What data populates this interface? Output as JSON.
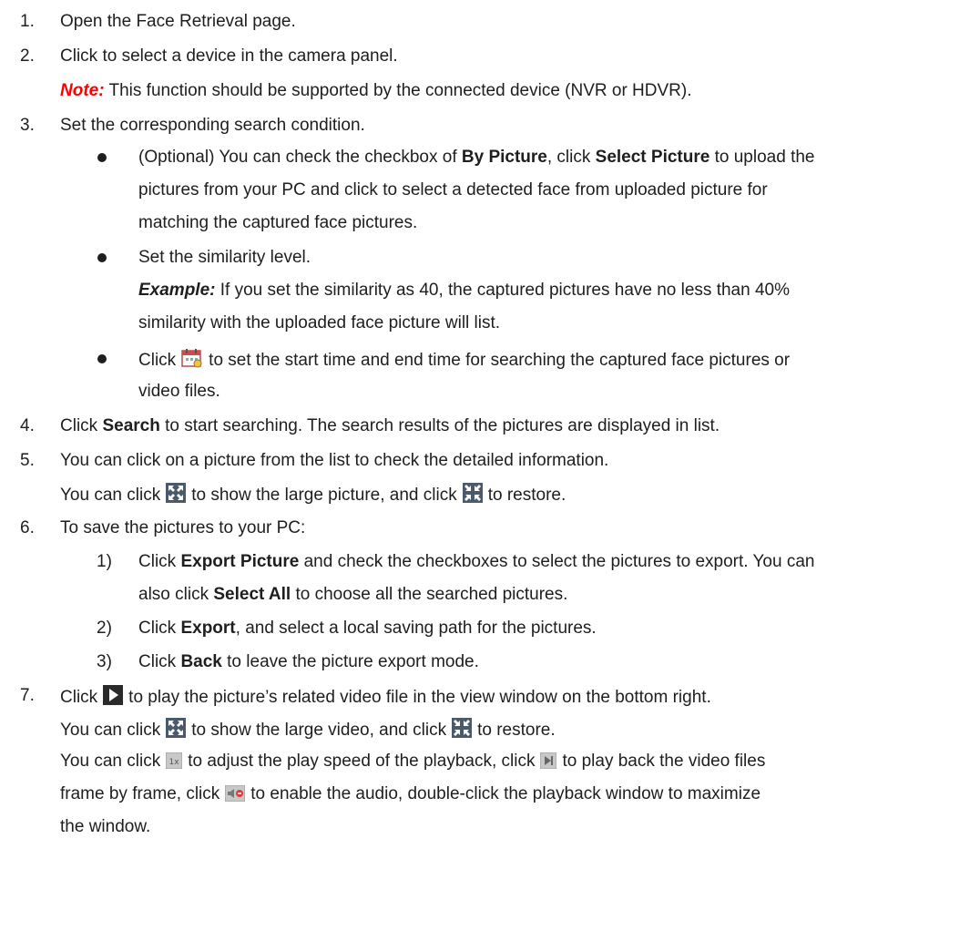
{
  "steps": [
    {
      "num": "1.",
      "text": "Open the Face Retrieval page."
    },
    {
      "num": "2.",
      "text": "Click to select a device in the camera panel."
    },
    {
      "num": "3.",
      "text": "Set the corresponding search condition."
    },
    {
      "num": "4.",
      "text_a": "Click ",
      "b1": "Search",
      "text_b": " to start searching. The search results of the pictures are displayed in list."
    },
    {
      "num": "5.",
      "text": "You can click on a picture from the list to check the detailed information."
    },
    {
      "num": "6.",
      "text": "To save the pictures to your PC:"
    },
    {
      "num": "7.",
      "text_a": "Click",
      "text_b": "to play the picture’s related video file in the view window on the bottom right."
    }
  ],
  "step2_note": {
    "label": "Note:",
    "text": " This function should be supported by the connected device (NVR or HDVR)."
  },
  "step3": {
    "b1_pre": "(Optional) You can check the checkbox of ",
    "b1_bold1": "By Picture",
    "b1_mid": ", click ",
    "b1_bold2": "Select Picture",
    "b1_post": " to upload the",
    "b1_l2": "pictures from your PC and click to select a detected face from uploaded picture for",
    "b1_l3": "matching the captured face pictures.",
    "b2": "Set the similarity level.",
    "b2_ex_label": "Example:",
    "b2_ex_text": " If you set the similarity as 40, the captured pictures have no less than 40%",
    "b2_ex_l2": "similarity with the uploaded face picture will list.",
    "b3_pre": "Click",
    "b3_post": "to set the start time and end time for searching the captured face pictures or",
    "b3_l2": "video files."
  },
  "step5_line2": {
    "pre": "You can click",
    "mid": "to show the large picture, and click",
    "post": "to restore."
  },
  "step6": [
    {
      "num": "1)",
      "pre": "Click ",
      "bold": "Export Picture",
      "post": " and check the checkboxes to select the pictures to export. You can",
      "l2_pre": "also click ",
      "l2_bold": "Select All",
      "l2_post": " to choose all the searched pictures."
    },
    {
      "num": "2)",
      "pre": "Click ",
      "bold": "Export",
      "post": ", and select a local saving path for the pictures."
    },
    {
      "num": "3)",
      "pre": "Click ",
      "bold": "Back",
      "post": " to leave the picture export mode."
    }
  ],
  "step7_line2": {
    "pre": "You can click",
    "mid": "to show the large video, and click",
    "post": "to restore."
  },
  "step7_line3": {
    "pre": "You can click",
    "mid": "to adjust the play speed of the playback, click",
    "post": "to play back the video files"
  },
  "step7_line4": {
    "pre": "frame by frame, click",
    "post": "to enable the audio, double-click the playback window to maximize"
  },
  "step7_line5": "the window.",
  "icons": {
    "calendar": "calendar-icon",
    "fullscreen": "fullscreen-icon",
    "restore": "restore-icon",
    "play": "play-icon",
    "speed": "speed-1x-icon",
    "frame": "frame-step-icon",
    "audio": "audio-icon"
  }
}
